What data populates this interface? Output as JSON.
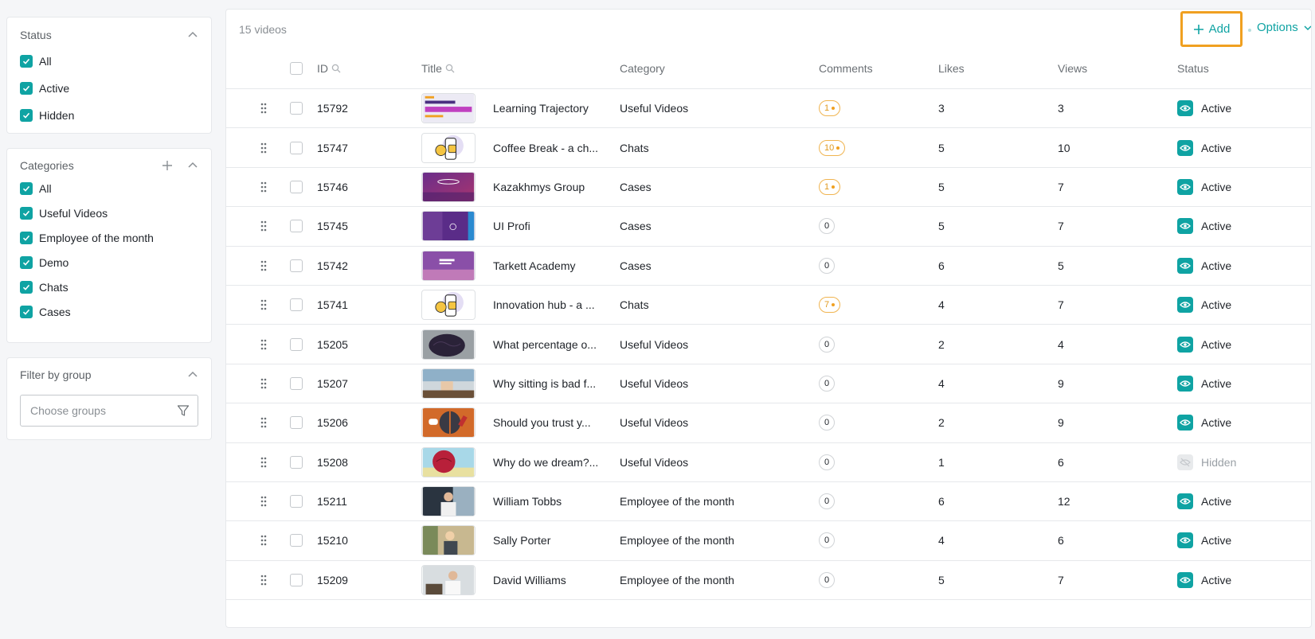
{
  "status_filter": {
    "title": "Status",
    "items": [
      {
        "label": "All",
        "checked": true
      },
      {
        "label": "Active",
        "checked": true
      },
      {
        "label": "Hidden",
        "checked": true
      }
    ]
  },
  "categories_filter": {
    "title": "Categories",
    "items": [
      {
        "label": "All",
        "checked": true
      },
      {
        "label": "Useful Videos",
        "checked": true
      },
      {
        "label": "Employee of the month",
        "checked": true
      },
      {
        "label": "Demo",
        "checked": true
      },
      {
        "label": "Chats",
        "checked": true
      },
      {
        "label": "Cases",
        "checked": true
      }
    ]
  },
  "group_filter": {
    "title": "Filter by group",
    "placeholder": "Choose groups"
  },
  "toolbar": {
    "count": "15 videos",
    "add_label": "Add",
    "options_label": "Options"
  },
  "table": {
    "headers": {
      "id": "ID",
      "title": "Title",
      "category": "Category",
      "comments": "Comments",
      "likes": "Likes",
      "views": "Views",
      "status": "Status"
    },
    "rows": [
      {
        "id": "15792",
        "title": "Learning Trajectory",
        "category": "Useful Videos",
        "comments": "1",
        "new_comments": true,
        "likes": "3",
        "views": "3",
        "status": "Active",
        "thumb": "promo"
      },
      {
        "id": "15747",
        "title": "Coffee Break - a ch...",
        "category": "Chats",
        "comments": "10",
        "new_comments": true,
        "likes": "5",
        "views": "10",
        "status": "Active",
        "thumb": "chat"
      },
      {
        "id": "15746",
        "title": "Kazakhmys Group",
        "category": "Cases",
        "comments": "1",
        "new_comments": true,
        "likes": "5",
        "views": "7",
        "status": "Active",
        "thumb": "purple"
      },
      {
        "id": "15745",
        "title": "UI Profi",
        "category": "Cases",
        "comments": "0",
        "new_comments": false,
        "likes": "5",
        "views": "7",
        "status": "Active",
        "thumb": "purple2"
      },
      {
        "id": "15742",
        "title": "Tarkett Academy",
        "category": "Cases",
        "comments": "0",
        "new_comments": false,
        "likes": "6",
        "views": "5",
        "status": "Active",
        "thumb": "purple3"
      },
      {
        "id": "15741",
        "title": "Innovation hub - a ...",
        "category": "Chats",
        "comments": "7",
        "new_comments": true,
        "likes": "4",
        "views": "7",
        "status": "Active",
        "thumb": "chat"
      },
      {
        "id": "15205",
        "title": "What percentage o...",
        "category": "Useful Videos",
        "comments": "0",
        "new_comments": false,
        "likes": "2",
        "views": "4",
        "status": "Active",
        "thumb": "brain"
      },
      {
        "id": "15207",
        "title": "Why sitting is bad f...",
        "category": "Useful Videos",
        "comments": "0",
        "new_comments": false,
        "likes": "4",
        "views": "9",
        "status": "Active",
        "thumb": "office"
      },
      {
        "id": "15206",
        "title": "Should you trust y...",
        "category": "Useful Videos",
        "comments": "0",
        "new_comments": false,
        "likes": "2",
        "views": "9",
        "status": "Active",
        "thumb": "orange"
      },
      {
        "id": "15208",
        "title": "Why do we dream?...",
        "category": "Useful Videos",
        "comments": "0",
        "new_comments": false,
        "likes": "1",
        "views": "6",
        "status": "Hidden",
        "thumb": "dream"
      },
      {
        "id": "15211",
        "title": "William Tobbs",
        "category": "Employee of the month",
        "comments": "0",
        "new_comments": false,
        "likes": "6",
        "views": "12",
        "status": "Active",
        "thumb": "person"
      },
      {
        "id": "15210",
        "title": "Sally Porter",
        "category": "Employee of the month",
        "comments": "0",
        "new_comments": false,
        "likes": "4",
        "views": "6",
        "status": "Active",
        "thumb": "person2"
      },
      {
        "id": "15209",
        "title": "David Williams",
        "category": "Employee of the month",
        "comments": "0",
        "new_comments": false,
        "likes": "5",
        "views": "7",
        "status": "Active",
        "thumb": "person3"
      }
    ]
  },
  "colors": {
    "accent": "#0fa3a3",
    "highlight": "#f0a020",
    "warning_badge": "#e09a20"
  }
}
